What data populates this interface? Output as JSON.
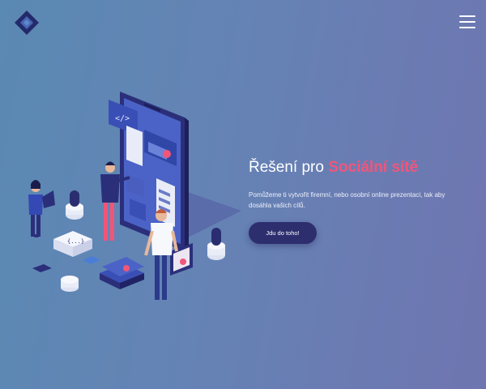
{
  "header": {
    "logo_icon": "diamond-logo-icon",
    "menu_icon": "hamburger-menu-icon"
  },
  "hero": {
    "title_prefix": "Řešení pro ",
    "title_highlight": "Sociální sítě",
    "description": "Pomůžeme ti vytvořit firemní, nebo osobní online prezentaci, tak aby dosáhla vašich cílů.",
    "cta_label": "Jdu do toho!",
    "code_icon_text": "</>"
  },
  "colors": {
    "background_start": "#5a89b3",
    "background_end": "#6f75b0",
    "highlight": "#f2557a",
    "button": "#2d2e6e"
  }
}
